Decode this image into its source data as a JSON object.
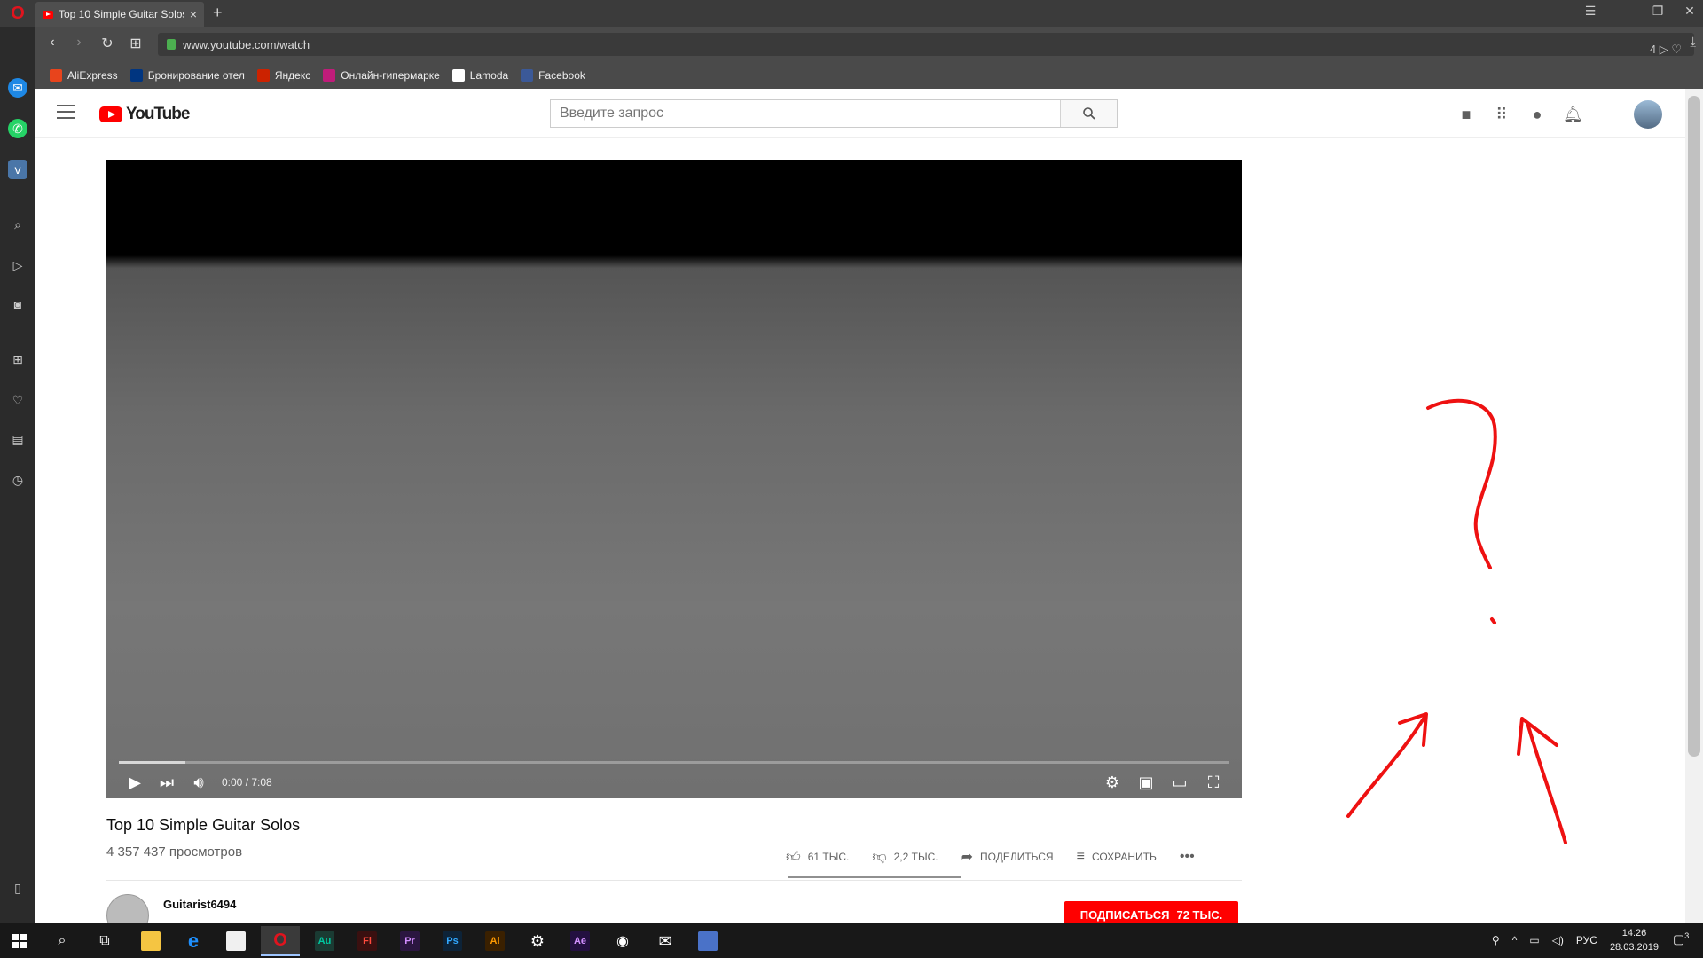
{
  "browser": {
    "tab_title": "Top 10 Simple Guitar Solos",
    "new_tab": "+",
    "tab_close": "×",
    "url": "www.youtube.com/watch",
    "url_badge": "4",
    "bookmarks": [
      {
        "label": "AliExpress",
        "color": "#e8441c"
      },
      {
        "label": "Бронирование отел",
        "color": "#003580"
      },
      {
        "label": "Яндекс",
        "color": "#cc2200"
      },
      {
        "label": "Онлайн-гипермарке",
        "color": "#c01c7a"
      },
      {
        "label": "Lamoda",
        "color": "#111111"
      },
      {
        "label": "Facebook",
        "color": "#3b5998"
      }
    ]
  },
  "youtube": {
    "logo_text": "YouTube",
    "search_placeholder": "Введите запрос",
    "video_title": "Top 10 Simple Guitar Solos",
    "views": "4 357 437 просмотров",
    "time": "0:00 / 7:08",
    "progress_loaded_fraction": 0.06,
    "likes": "61 ТЫС.",
    "dislikes": "2,2 ТЫС.",
    "share_label": "ПОДЕЛИТЬСЯ",
    "save_label": "СОХРАНИТЬ",
    "more_label": "•••",
    "channel_name": "Guitarist6494",
    "subscribe_label": "ПОДПИСАТЬСЯ",
    "subscriber_count": "72 ТЫС."
  },
  "taskbar": {
    "apps": [
      {
        "name": "Au",
        "color": "#00c8a0",
        "bg": "#1a3b33"
      },
      {
        "name": "Fl",
        "color": "#ff4a3d",
        "bg": "#3a1010"
      },
      {
        "name": "Pr",
        "color": "#d28cff",
        "bg": "#2b1640"
      },
      {
        "name": "Ps",
        "color": "#31a8ff",
        "bg": "#0d2338"
      },
      {
        "name": "Ai",
        "color": "#ff9a00",
        "bg": "#3a2000"
      },
      {
        "name": "Ae",
        "color": "#d291ff",
        "bg": "#231040"
      }
    ],
    "lang": "РУС",
    "time": "14:26",
    "date": "28.03.2019",
    "notifications": "3"
  },
  "colors": {
    "accent": "#ff0000",
    "annotation": "#ee1111"
  }
}
